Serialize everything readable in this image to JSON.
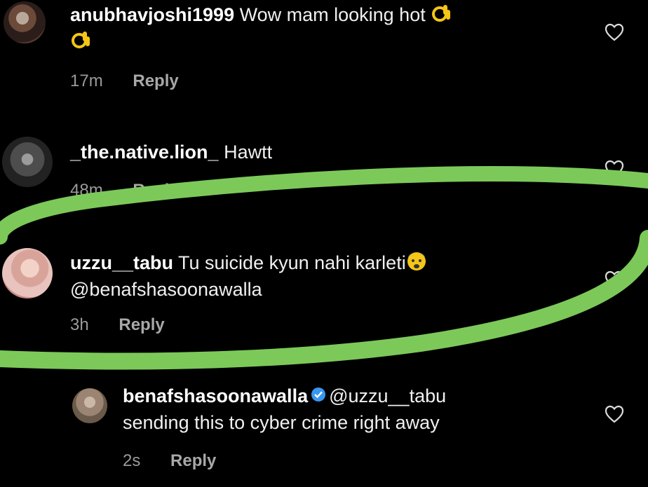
{
  "comments": [
    {
      "username": "anubhavjoshi1999",
      "text": "Wow mam looking hot",
      "time": "17m",
      "reply_label": "Reply",
      "emoji": "ok-hand"
    },
    {
      "username": "_the.native.lion_",
      "text": "Hawtt",
      "time": "48m",
      "reply_label": "Reply"
    },
    {
      "username": "uzzu__tabu",
      "text": "Tu suicide kyun nahi karleti",
      "mention": "@benafshasoonawalla",
      "time": "3h",
      "reply_label": "Reply",
      "emoji": "anxious-face"
    }
  ],
  "reply": {
    "username": "benafshasoonawalla",
    "verified": true,
    "mention": "@uzzu__tabu",
    "text": "sending this to cyber crime right away",
    "time": "2s",
    "reply_label": "Reply"
  },
  "colors": {
    "background": "#000000",
    "text": "#f0f0f0",
    "meta": "#9a9a9a",
    "highlight": "#7cc95a",
    "verified": "#3897f0"
  }
}
